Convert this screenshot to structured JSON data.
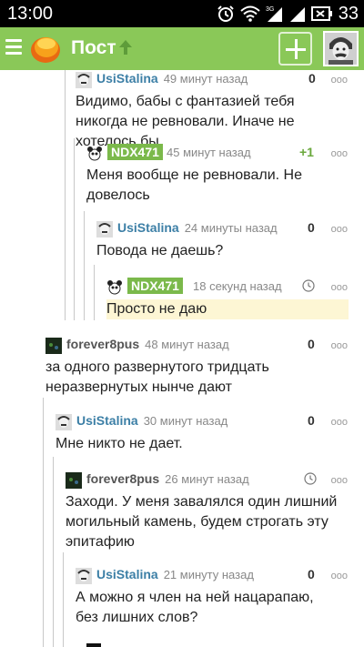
{
  "status_bar": {
    "time": "13:00",
    "battery": "33",
    "icons": [
      "alarm-icon",
      "wifi-icon",
      "signal-3g-icon",
      "signal-icon",
      "battery-icon"
    ]
  },
  "app_bar": {
    "title": "Пост",
    "icons": [
      "menu-icon",
      "logo",
      "arrow-up-icon",
      "add-icon",
      "avatar"
    ]
  },
  "colors": {
    "accent": "#8ac858",
    "username": "#3c7fa6",
    "author_badge": "#7bb94b",
    "highlight": "#fdf6d4"
  },
  "comments": [
    {
      "user": "UsiStalina",
      "time": "49 минут назад",
      "rating": "0",
      "text": "Видимо, бабы с фантазией тебя никогда не ревновали. Иначе не хотелось бы."
    },
    {
      "user": "NDX471",
      "time": "45 минут назад",
      "rating": "+1",
      "text": "Меня вообще не ревновали. Не довелось"
    },
    {
      "user": "UsiStalina",
      "time": "24 минуты назад",
      "rating": "0",
      "text": "Повода не даешь?"
    },
    {
      "user": "NDX471",
      "time": "18 секунд назад",
      "rating": "",
      "text": "Просто не даю"
    },
    {
      "user": "forever8pus",
      "time": "48 минут назад",
      "rating": "0",
      "text": "за одного развернутого тридцать неразвернутых нынче дают"
    },
    {
      "user": "UsiStalina",
      "time": "30 минут назад",
      "rating": "0",
      "text": "Мне никто не дает."
    },
    {
      "user": "forever8pus",
      "time": "26 минут назад",
      "rating": "",
      "text": "Заходи. У меня завалялся один лишний могильный камень, будем строгать эту эпитафию"
    },
    {
      "user": "UsiStalina",
      "time": "21 минуту назад",
      "rating": "0",
      "text": "А можно я член на ней нацарапаю, без лишних слов?"
    }
  ],
  "more_label": "ооо"
}
